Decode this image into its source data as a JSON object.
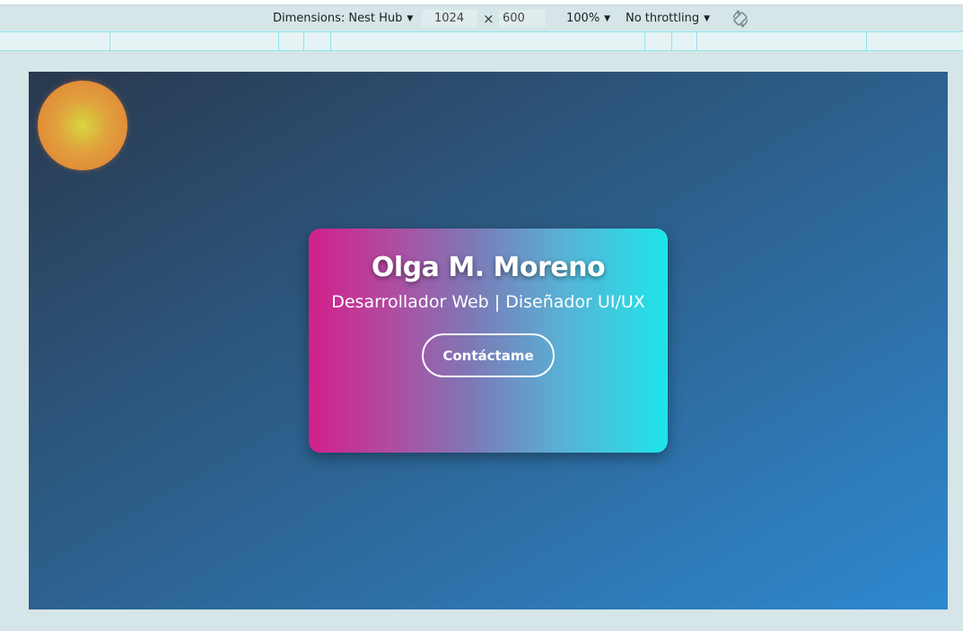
{
  "devtools": {
    "device_label": "Dimensions: Nest Hub",
    "width_value": "1024",
    "times_symbol": "×",
    "height_value": "600",
    "zoom_label": "100%",
    "throttling_label": "No throttling",
    "caret": "▼",
    "rotate_icon": "rotate-icon"
  },
  "page": {
    "name": "Olga M. Moreno",
    "role": "Desarrollador Web | Diseñador UI/UX",
    "contact_button": "Contáctame"
  },
  "colors": {
    "background_start": "#29394f",
    "background_end": "#2e89d0",
    "card_left": "#d2208a",
    "card_right": "#1ee5ea",
    "sun_center": "#d7d640",
    "sun_edge": "#e27a35"
  }
}
